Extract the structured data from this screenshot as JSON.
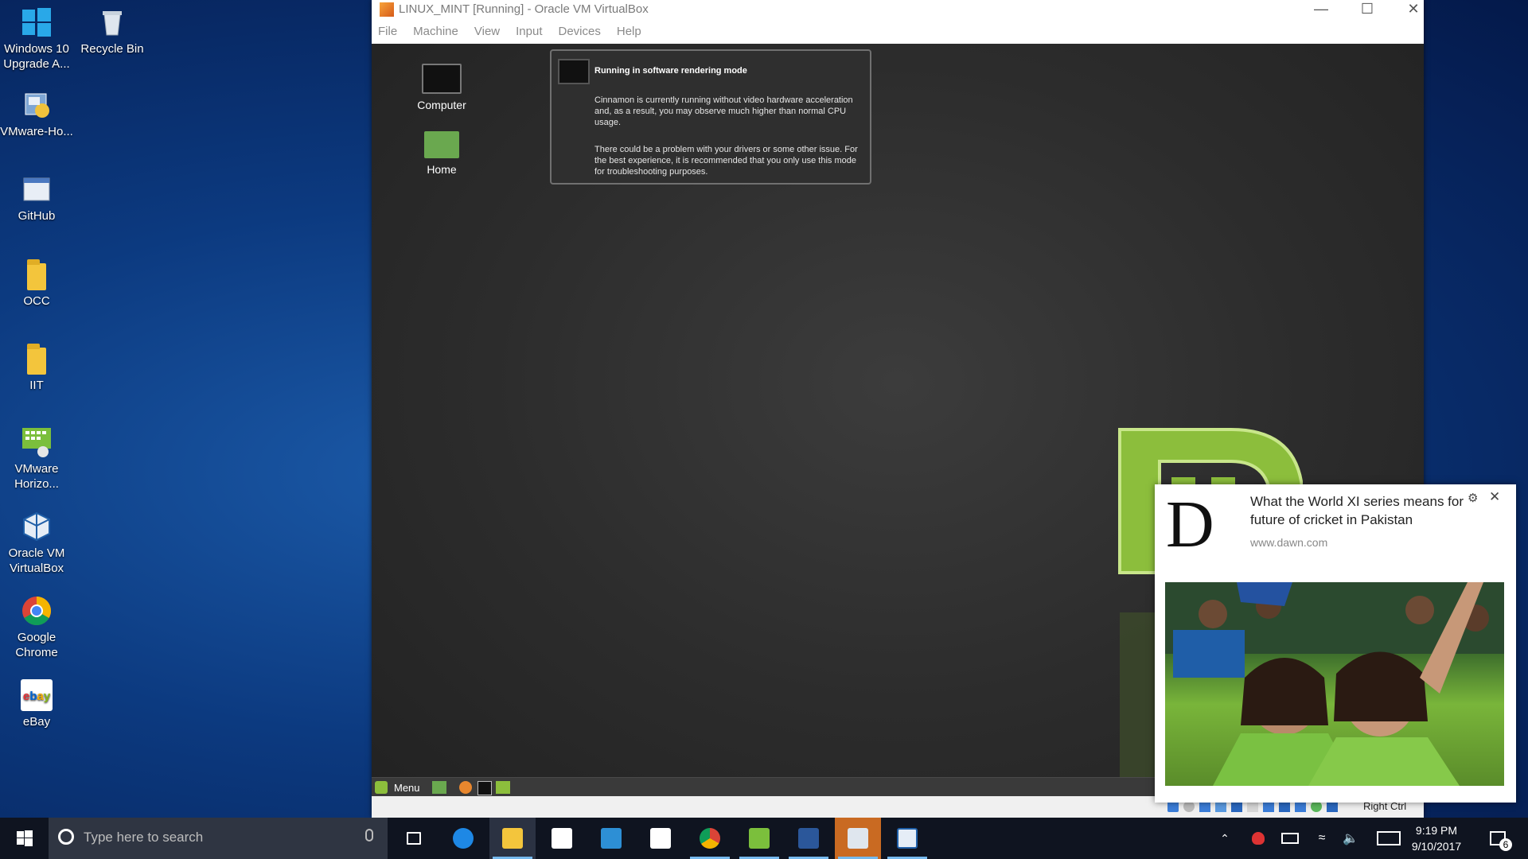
{
  "desktop": {
    "icons": [
      {
        "label": "Windows 10 Upgrade A..."
      },
      {
        "label": "Recycle Bin"
      },
      {
        "label": "VMware-Ho..."
      },
      {
        "label": "GitHub"
      },
      {
        "label": "OCC"
      },
      {
        "label": "IIT"
      },
      {
        "label": "VMware Horizo..."
      },
      {
        "label": "Oracle VM VirtualBox"
      },
      {
        "label": "Google Chrome"
      },
      {
        "label": "eBay"
      }
    ]
  },
  "vbox": {
    "title": "LINUX_MINT [Running] - Oracle VM VirtualBox",
    "menu": [
      "File",
      "Machine",
      "View",
      "Input",
      "Devices",
      "Help"
    ],
    "status_hostkey": "Right Ctrl"
  },
  "mint": {
    "icons": [
      {
        "label": "Computer"
      },
      {
        "label": "Home"
      }
    ],
    "notice": {
      "heading": "Running in software rendering mode",
      "para1": "Cinnamon is currently running without video hardware acceleration and, as a result, you may observe much higher than normal CPU usage.",
      "para2": "There could be a problem with your drivers or some other issue.  For the best experience, it is recommended that you only use this mode for troubleshooting purposes."
    },
    "panel_menu": "Menu"
  },
  "toast": {
    "logo_letter": "D",
    "title": "What the World XI series means for future of cricket in Pakistan",
    "source": "www.dawn.com"
  },
  "taskbar": {
    "search_placeholder": "Type here to search",
    "time": "9:19 PM",
    "date": "9/10/2017",
    "notifications_count": "6"
  },
  "colors": {
    "taskbar_bg": "#0f1420",
    "active_indicator": "#76b9ed",
    "mint_green": "#8cbe3c"
  }
}
